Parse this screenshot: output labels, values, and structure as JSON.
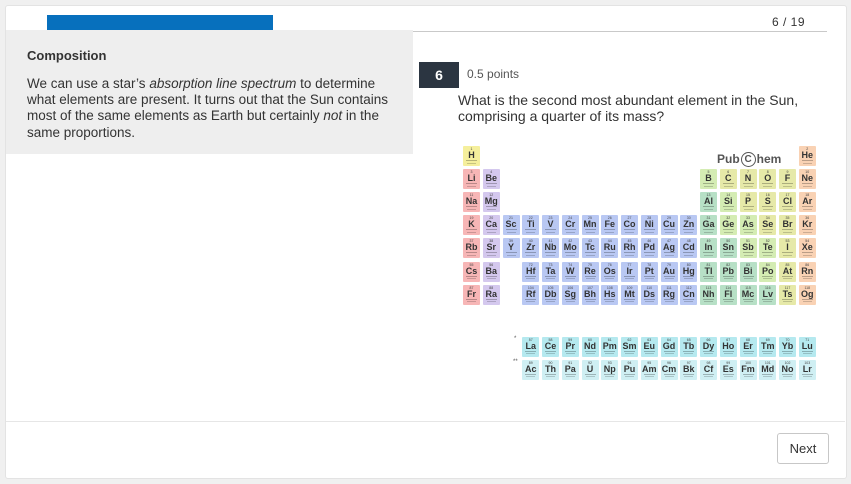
{
  "progress": {
    "current": 6,
    "total": 19,
    "label": "6 / 19",
    "fill_fraction": 0.29
  },
  "composition": {
    "title": "Composition",
    "body_1": "We can use a star’s ",
    "body_em": "absorption line spectrum",
    "body_2": " to determine what elements are present. It turns out that the Sun contains most of the same elements as Earth but certainly ",
    "body_em2": "not",
    "body_3": " in the same proportions."
  },
  "question": {
    "number": "6",
    "points": "0.5 points",
    "text": "What is the second most abundant element in the Sun, comprising a quarter of its mass?"
  },
  "periodic_table": {
    "logo": {
      "left": "Pub",
      "circle": "C",
      "right": "hem"
    },
    "lanthanide_marker": "*",
    "actinide_marker": "**",
    "colors": {
      "nonmetal": "#e6e9a8",
      "noble": "#f9d2b4",
      "alkali": "#f7b6b6",
      "alkaline": "#d4c8ee",
      "transition": "#b9c8f3",
      "post": "#b7e0c6",
      "metalloid": "#d4ecb3",
      "halogen": "#e6e9a8",
      "lanthanide": "#b5e9ef",
      "actinide": "#cfeff3",
      "hydrogen": "#f5ef9c"
    },
    "elements": [
      {
        "z": 1,
        "s": "H",
        "r": 0,
        "c": 0,
        "t": "hydrogen"
      },
      {
        "z": 2,
        "s": "He",
        "r": 0,
        "c": 17,
        "t": "noble"
      },
      {
        "z": 3,
        "s": "Li",
        "r": 1,
        "c": 0,
        "t": "alkali"
      },
      {
        "z": 4,
        "s": "Be",
        "r": 1,
        "c": 1,
        "t": "alkaline"
      },
      {
        "z": 5,
        "s": "B",
        "r": 1,
        "c": 12,
        "t": "metalloid"
      },
      {
        "z": 6,
        "s": "C",
        "r": 1,
        "c": 13,
        "t": "nonmetal"
      },
      {
        "z": 7,
        "s": "N",
        "r": 1,
        "c": 14,
        "t": "nonmetal"
      },
      {
        "z": 8,
        "s": "O",
        "r": 1,
        "c": 15,
        "t": "nonmetal"
      },
      {
        "z": 9,
        "s": "F",
        "r": 1,
        "c": 16,
        "t": "halogen"
      },
      {
        "z": 10,
        "s": "Ne",
        "r": 1,
        "c": 17,
        "t": "noble"
      },
      {
        "z": 11,
        "s": "Na",
        "r": 2,
        "c": 0,
        "t": "alkali"
      },
      {
        "z": 12,
        "s": "Mg",
        "r": 2,
        "c": 1,
        "t": "alkaline"
      },
      {
        "z": 13,
        "s": "Al",
        "r": 2,
        "c": 12,
        "t": "post"
      },
      {
        "z": 14,
        "s": "Si",
        "r": 2,
        "c": 13,
        "t": "metalloid"
      },
      {
        "z": 15,
        "s": "P",
        "r": 2,
        "c": 14,
        "t": "nonmetal"
      },
      {
        "z": 16,
        "s": "S",
        "r": 2,
        "c": 15,
        "t": "nonmetal"
      },
      {
        "z": 17,
        "s": "Cl",
        "r": 2,
        "c": 16,
        "t": "halogen"
      },
      {
        "z": 18,
        "s": "Ar",
        "r": 2,
        "c": 17,
        "t": "noble"
      },
      {
        "z": 19,
        "s": "K",
        "r": 3,
        "c": 0,
        "t": "alkali"
      },
      {
        "z": 20,
        "s": "Ca",
        "r": 3,
        "c": 1,
        "t": "alkaline"
      },
      {
        "z": 21,
        "s": "Sc",
        "r": 3,
        "c": 2,
        "t": "transition"
      },
      {
        "z": 22,
        "s": "Ti",
        "r": 3,
        "c": 3,
        "t": "transition"
      },
      {
        "z": 23,
        "s": "V",
        "r": 3,
        "c": 4,
        "t": "transition"
      },
      {
        "z": 24,
        "s": "Cr",
        "r": 3,
        "c": 5,
        "t": "transition"
      },
      {
        "z": 25,
        "s": "Mn",
        "r": 3,
        "c": 6,
        "t": "transition"
      },
      {
        "z": 26,
        "s": "Fe",
        "r": 3,
        "c": 7,
        "t": "transition"
      },
      {
        "z": 27,
        "s": "Co",
        "r": 3,
        "c": 8,
        "t": "transition"
      },
      {
        "z": 28,
        "s": "Ni",
        "r": 3,
        "c": 9,
        "t": "transition"
      },
      {
        "z": 29,
        "s": "Cu",
        "r": 3,
        "c": 10,
        "t": "transition"
      },
      {
        "z": 30,
        "s": "Zn",
        "r": 3,
        "c": 11,
        "t": "transition"
      },
      {
        "z": 31,
        "s": "Ga",
        "r": 3,
        "c": 12,
        "t": "post"
      },
      {
        "z": 32,
        "s": "Ge",
        "r": 3,
        "c": 13,
        "t": "metalloid"
      },
      {
        "z": 33,
        "s": "As",
        "r": 3,
        "c": 14,
        "t": "metalloid"
      },
      {
        "z": 34,
        "s": "Se",
        "r": 3,
        "c": 15,
        "t": "nonmetal"
      },
      {
        "z": 35,
        "s": "Br",
        "r": 3,
        "c": 16,
        "t": "halogen"
      },
      {
        "z": 36,
        "s": "Kr",
        "r": 3,
        "c": 17,
        "t": "noble"
      },
      {
        "z": 37,
        "s": "Rb",
        "r": 4,
        "c": 0,
        "t": "alkali"
      },
      {
        "z": 38,
        "s": "Sr",
        "r": 4,
        "c": 1,
        "t": "alkaline"
      },
      {
        "z": 39,
        "s": "Y",
        "r": 4,
        "c": 2,
        "t": "transition"
      },
      {
        "z": 40,
        "s": "Zr",
        "r": 4,
        "c": 3,
        "t": "transition"
      },
      {
        "z": 41,
        "s": "Nb",
        "r": 4,
        "c": 4,
        "t": "transition"
      },
      {
        "z": 42,
        "s": "Mo",
        "r": 4,
        "c": 5,
        "t": "transition"
      },
      {
        "z": 43,
        "s": "Tc",
        "r": 4,
        "c": 6,
        "t": "transition"
      },
      {
        "z": 44,
        "s": "Ru",
        "r": 4,
        "c": 7,
        "t": "transition"
      },
      {
        "z": 45,
        "s": "Rh",
        "r": 4,
        "c": 8,
        "t": "transition"
      },
      {
        "z": 46,
        "s": "Pd",
        "r": 4,
        "c": 9,
        "t": "transition"
      },
      {
        "z": 47,
        "s": "Ag",
        "r": 4,
        "c": 10,
        "t": "transition"
      },
      {
        "z": 48,
        "s": "Cd",
        "r": 4,
        "c": 11,
        "t": "transition"
      },
      {
        "z": 49,
        "s": "In",
        "r": 4,
        "c": 12,
        "t": "post"
      },
      {
        "z": 50,
        "s": "Sn",
        "r": 4,
        "c": 13,
        "t": "post"
      },
      {
        "z": 51,
        "s": "Sb",
        "r": 4,
        "c": 14,
        "t": "metalloid"
      },
      {
        "z": 52,
        "s": "Te",
        "r": 4,
        "c": 15,
        "t": "metalloid"
      },
      {
        "z": 53,
        "s": "I",
        "r": 4,
        "c": 16,
        "t": "halogen"
      },
      {
        "z": 54,
        "s": "Xe",
        "r": 4,
        "c": 17,
        "t": "noble"
      },
      {
        "z": 55,
        "s": "Cs",
        "r": 5,
        "c": 0,
        "t": "alkali"
      },
      {
        "z": 56,
        "s": "Ba",
        "r": 5,
        "c": 1,
        "t": "alkaline"
      },
      {
        "z": 72,
        "s": "Hf",
        "r": 5,
        "c": 3,
        "t": "transition"
      },
      {
        "z": 73,
        "s": "Ta",
        "r": 5,
        "c": 4,
        "t": "transition"
      },
      {
        "z": 74,
        "s": "W",
        "r": 5,
        "c": 5,
        "t": "transition"
      },
      {
        "z": 75,
        "s": "Re",
        "r": 5,
        "c": 6,
        "t": "transition"
      },
      {
        "z": 76,
        "s": "Os",
        "r": 5,
        "c": 7,
        "t": "transition"
      },
      {
        "z": 77,
        "s": "Ir",
        "r": 5,
        "c": 8,
        "t": "transition"
      },
      {
        "z": 78,
        "s": "Pt",
        "r": 5,
        "c": 9,
        "t": "transition"
      },
      {
        "z": 79,
        "s": "Au",
        "r": 5,
        "c": 10,
        "t": "transition"
      },
      {
        "z": 80,
        "s": "Hg",
        "r": 5,
        "c": 11,
        "t": "transition"
      },
      {
        "z": 81,
        "s": "Tl",
        "r": 5,
        "c": 12,
        "t": "post"
      },
      {
        "z": 82,
        "s": "Pb",
        "r": 5,
        "c": 13,
        "t": "post"
      },
      {
        "z": 83,
        "s": "Bi",
        "r": 5,
        "c": 14,
        "t": "post"
      },
      {
        "z": 84,
        "s": "Po",
        "r": 5,
        "c": 15,
        "t": "metalloid"
      },
      {
        "z": 85,
        "s": "At",
        "r": 5,
        "c": 16,
        "t": "halogen"
      },
      {
        "z": 86,
        "s": "Rn",
        "r": 5,
        "c": 17,
        "t": "noble"
      },
      {
        "z": 87,
        "s": "Fr",
        "r": 6,
        "c": 0,
        "t": "alkali"
      },
      {
        "z": 88,
        "s": "Ra",
        "r": 6,
        "c": 1,
        "t": "alkaline"
      },
      {
        "z": 104,
        "s": "Rf",
        "r": 6,
        "c": 3,
        "t": "transition"
      },
      {
        "z": 105,
        "s": "Db",
        "r": 6,
        "c": 4,
        "t": "transition"
      },
      {
        "z": 106,
        "s": "Sg",
        "r": 6,
        "c": 5,
        "t": "transition"
      },
      {
        "z": 107,
        "s": "Bh",
        "r": 6,
        "c": 6,
        "t": "transition"
      },
      {
        "z": 108,
        "s": "Hs",
        "r": 6,
        "c": 7,
        "t": "transition"
      },
      {
        "z": 109,
        "s": "Mt",
        "r": 6,
        "c": 8,
        "t": "transition"
      },
      {
        "z": 110,
        "s": "Ds",
        "r": 6,
        "c": 9,
        "t": "transition"
      },
      {
        "z": 111,
        "s": "Rg",
        "r": 6,
        "c": 10,
        "t": "transition"
      },
      {
        "z": 112,
        "s": "Cn",
        "r": 6,
        "c": 11,
        "t": "transition"
      },
      {
        "z": 113,
        "s": "Nh",
        "r": 6,
        "c": 12,
        "t": "post"
      },
      {
        "z": 114,
        "s": "Fl",
        "r": 6,
        "c": 13,
        "t": "post"
      },
      {
        "z": 115,
        "s": "Mc",
        "r": 6,
        "c": 14,
        "t": "post"
      },
      {
        "z": 116,
        "s": "Lv",
        "r": 6,
        "c": 15,
        "t": "post"
      },
      {
        "z": 117,
        "s": "Ts",
        "r": 6,
        "c": 16,
        "t": "halogen"
      },
      {
        "z": 118,
        "s": "Og",
        "r": 6,
        "c": 17,
        "t": "noble"
      },
      {
        "z": 57,
        "s": "La",
        "r": 8,
        "c": 3,
        "t": "lanthanide"
      },
      {
        "z": 58,
        "s": "Ce",
        "r": 8,
        "c": 4,
        "t": "lanthanide"
      },
      {
        "z": 59,
        "s": "Pr",
        "r": 8,
        "c": 5,
        "t": "lanthanide"
      },
      {
        "z": 60,
        "s": "Nd",
        "r": 8,
        "c": 6,
        "t": "lanthanide"
      },
      {
        "z": 61,
        "s": "Pm",
        "r": 8,
        "c": 7,
        "t": "lanthanide"
      },
      {
        "z": 62,
        "s": "Sm",
        "r": 8,
        "c": 8,
        "t": "lanthanide"
      },
      {
        "z": 63,
        "s": "Eu",
        "r": 8,
        "c": 9,
        "t": "lanthanide"
      },
      {
        "z": 64,
        "s": "Gd",
        "r": 8,
        "c": 10,
        "t": "lanthanide"
      },
      {
        "z": 65,
        "s": "Tb",
        "r": 8,
        "c": 11,
        "t": "lanthanide"
      },
      {
        "z": 66,
        "s": "Dy",
        "r": 8,
        "c": 12,
        "t": "lanthanide"
      },
      {
        "z": 67,
        "s": "Ho",
        "r": 8,
        "c": 13,
        "t": "lanthanide"
      },
      {
        "z": 68,
        "s": "Er",
        "r": 8,
        "c": 14,
        "t": "lanthanide"
      },
      {
        "z": 69,
        "s": "Tm",
        "r": 8,
        "c": 15,
        "t": "lanthanide"
      },
      {
        "z": 70,
        "s": "Yb",
        "r": 8,
        "c": 16,
        "t": "lanthanide"
      },
      {
        "z": 71,
        "s": "Lu",
        "r": 8,
        "c": 17,
        "t": "lanthanide"
      },
      {
        "z": 89,
        "s": "Ac",
        "r": 9,
        "c": 3,
        "t": "actinide"
      },
      {
        "z": 90,
        "s": "Th",
        "r": 9,
        "c": 4,
        "t": "actinide"
      },
      {
        "z": 91,
        "s": "Pa",
        "r": 9,
        "c": 5,
        "t": "actinide"
      },
      {
        "z": 92,
        "s": "U",
        "r": 9,
        "c": 6,
        "t": "actinide"
      },
      {
        "z": 93,
        "s": "Np",
        "r": 9,
        "c": 7,
        "t": "actinide"
      },
      {
        "z": 94,
        "s": "Pu",
        "r": 9,
        "c": 8,
        "t": "actinide"
      },
      {
        "z": 95,
        "s": "Am",
        "r": 9,
        "c": 9,
        "t": "actinide"
      },
      {
        "z": 96,
        "s": "Cm",
        "r": 9,
        "c": 10,
        "t": "actinide"
      },
      {
        "z": 97,
        "s": "Bk",
        "r": 9,
        "c": 11,
        "t": "actinide"
      },
      {
        "z": 98,
        "s": "Cf",
        "r": 9,
        "c": 12,
        "t": "actinide"
      },
      {
        "z": 99,
        "s": "Es",
        "r": 9,
        "c": 13,
        "t": "actinide"
      },
      {
        "z": 100,
        "s": "Fm",
        "r": 9,
        "c": 14,
        "t": "actinide"
      },
      {
        "z": 101,
        "s": "Md",
        "r": 9,
        "c": 15,
        "t": "actinide"
      },
      {
        "z": 102,
        "s": "No",
        "r": 9,
        "c": 16,
        "t": "actinide"
      },
      {
        "z": 103,
        "s": "Lr",
        "r": 9,
        "c": 17,
        "t": "actinide"
      }
    ]
  },
  "footer": {
    "next_label": "Next"
  }
}
